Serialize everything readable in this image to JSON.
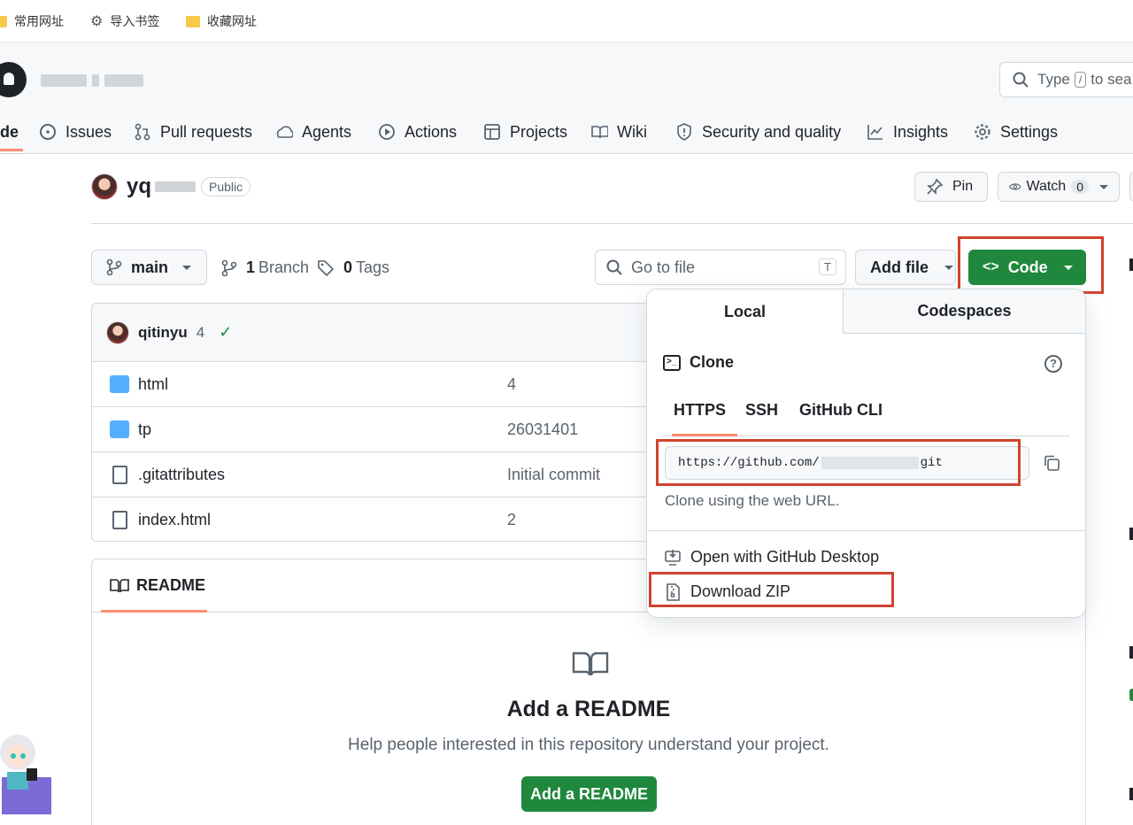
{
  "bookmarks": [
    {
      "label": "常用网址",
      "icon": "folder-icon"
    },
    {
      "label": "导入书签",
      "icon": "gear-icon"
    },
    {
      "label": "收藏网址",
      "icon": "folder-icon"
    }
  ],
  "header": {
    "search_prefix": "Type",
    "search_key": "/",
    "search_suffix": "to sea"
  },
  "nav": {
    "active_fragment": "de",
    "items": [
      "Issues",
      "Pull requests",
      "Agents",
      "Actions",
      "Projects",
      "Wiki",
      "Security and quality",
      "Insights",
      "Settings"
    ]
  },
  "repo": {
    "name_prefix": "yq",
    "visibility": "Public",
    "pin_label": "Pin",
    "watch_label": "Watch",
    "watch_count": "0"
  },
  "toolbar": {
    "branch": "main",
    "branch_count": "1",
    "branch_label": "Branch",
    "tag_count": "0",
    "tag_label": "Tags",
    "goto_placeholder": "Go to file",
    "goto_key": "T",
    "add_file": "Add file",
    "code": "Code"
  },
  "commit": {
    "user": "qitinyu",
    "message": "4"
  },
  "files": [
    {
      "name": "html",
      "message": "4",
      "type": "folder"
    },
    {
      "name": "tp",
      "message": "26031401",
      "type": "folder"
    },
    {
      "name": ".gitattributes",
      "message": "Initial commit",
      "type": "file"
    },
    {
      "name": "index.html",
      "message": "2",
      "type": "file"
    }
  ],
  "readme": {
    "tab": "README",
    "title": "Add a README",
    "subtitle": "Help people interested in this repository understand your project.",
    "button": "Add a README"
  },
  "clone_panel": {
    "tab_local": "Local",
    "tab_codespaces": "Codespaces",
    "clone_title": "Clone",
    "protocols": [
      "HTTPS",
      "SSH",
      "GitHub CLI"
    ],
    "url_prefix": "https://github.com/",
    "url_suffix": "git",
    "note": "Clone using the web URL.",
    "open_desktop": "Open with GitHub Desktop",
    "download_zip": "Download ZIP"
  },
  "colors": {
    "primary_green": "#1f883d",
    "highlight_red": "#d0432e",
    "tab_underline": "#fd8c73"
  }
}
